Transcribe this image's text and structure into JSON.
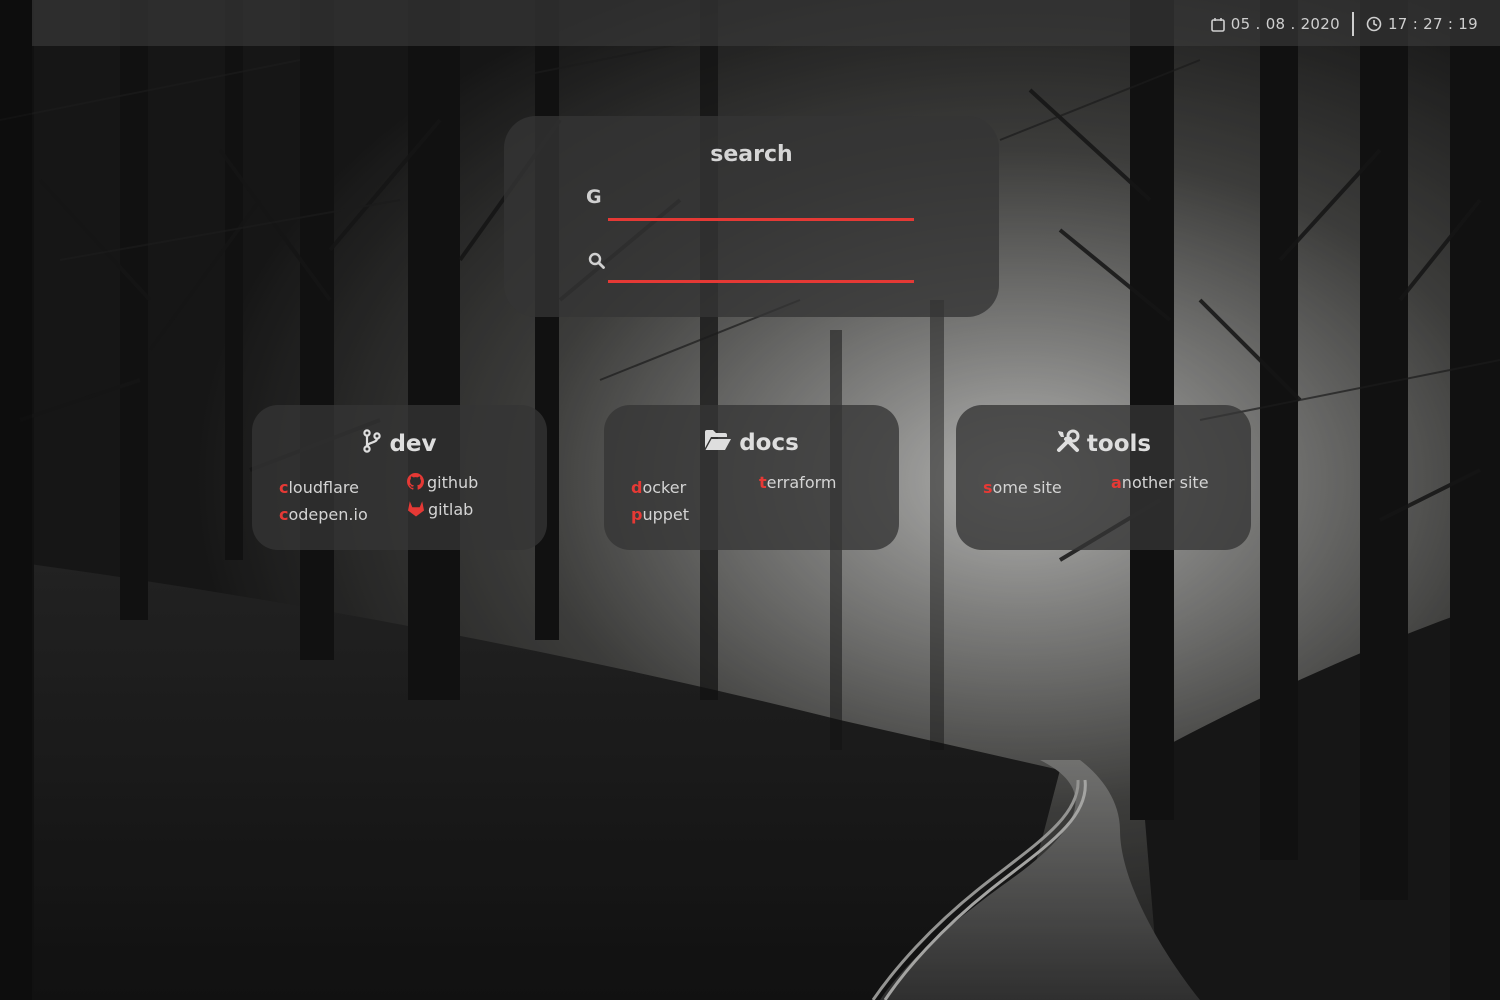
{
  "datetime": {
    "date": "05 . 08 . 2020",
    "time": "17 : 27 : 19"
  },
  "search": {
    "title": "search",
    "engines": [
      {
        "icon": "google-g-icon",
        "glyph": "G",
        "value": "",
        "placeholder": ""
      },
      {
        "icon": "magnifier-icon",
        "value": "",
        "placeholder": ""
      }
    ]
  },
  "cards": {
    "dev": {
      "title": "dev",
      "icon": "git-branch-icon",
      "links": [
        {
          "hotkey": "c",
          "rest": "loudflare"
        },
        {
          "hotkey": "c",
          "rest": "odepen.io"
        },
        {
          "label": "github",
          "icon": "github-icon"
        },
        {
          "label": "gitlab",
          "icon": "gitlab-icon"
        }
      ]
    },
    "docs": {
      "title": "docs",
      "icon": "folder-open-icon",
      "links": [
        {
          "hotkey": "d",
          "rest": "ocker"
        },
        {
          "hotkey": "p",
          "rest": "uppet"
        },
        {
          "hotkey": "t",
          "rest": "erraform"
        }
      ]
    },
    "tools": {
      "title": "tools",
      "icon": "tools-icon",
      "links": [
        {
          "hotkey": "s",
          "rest": "ome site"
        },
        {
          "hotkey": "a",
          "rest": "nother site"
        }
      ]
    }
  },
  "colors": {
    "accent": "#e53935",
    "panel": "#343434",
    "text": "#d9d9d9"
  }
}
